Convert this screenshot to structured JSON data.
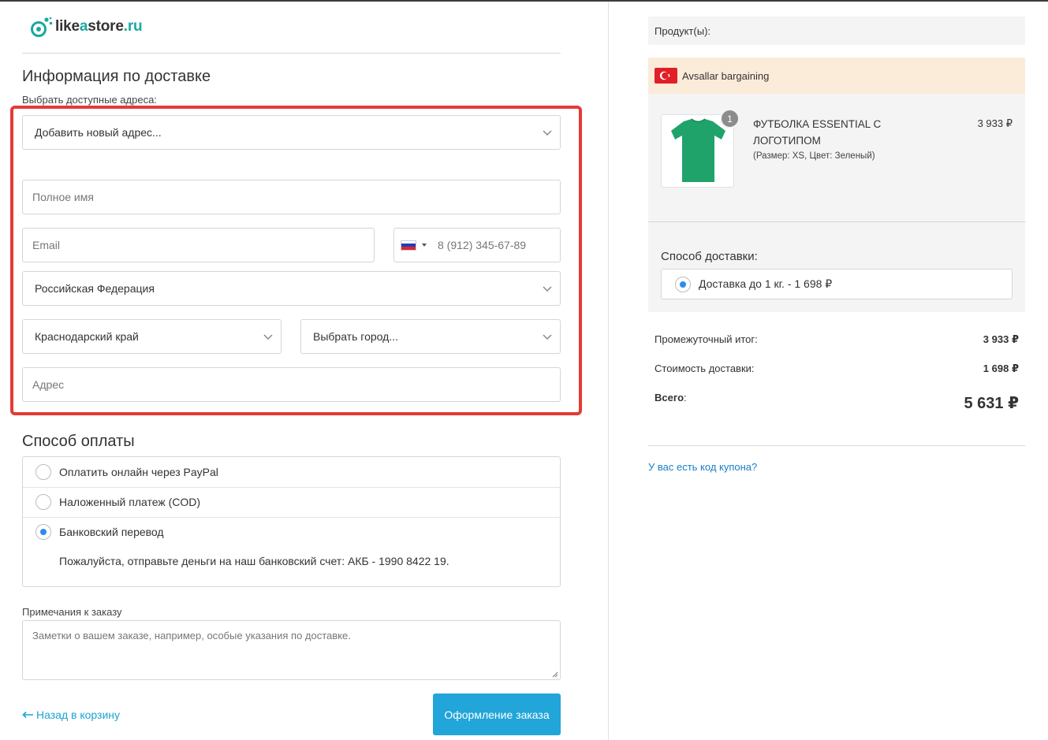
{
  "logo": {
    "part1": "like",
    "part2": "a",
    "part3": "store",
    "part4": ".ru"
  },
  "delivery": {
    "title": "Информация по доставке",
    "address_label": "Выбрать доступные адреса:",
    "address_select": "Добавить новый адрес...",
    "fullname_placeholder": "Полное имя",
    "email_placeholder": "Email",
    "phone_placeholder": "8 (912) 345-67-89",
    "country": "Российская Федерация",
    "region": "Краснодарский край",
    "city": "Выбрать город...",
    "address_placeholder": "Адрес"
  },
  "payment": {
    "title": "Способ оплаты",
    "options": [
      {
        "label": "Оплатить онлайн через PayPal",
        "selected": false
      },
      {
        "label": "Наложенный платеж (COD)",
        "selected": false
      },
      {
        "label": "Банковский перевод",
        "selected": true
      }
    ],
    "bank_note": "Пожалуйста, отправьте деньги на наш банковский счет: АКБ - 1990 8422 19."
  },
  "notes": {
    "label": "Примечания к заказу",
    "placeholder": "Заметки о вашем заказе, например, особые указания по доставке."
  },
  "footer": {
    "back_label": "Назад в корзину",
    "order_button": "Оформление заказа"
  },
  "summary": {
    "products_header": "Продукт(ы):",
    "seller": "Avsallar bargaining",
    "item": {
      "name": "ФУТБОЛКА ESSENTIAL С ЛОГОТИПОМ",
      "variant": "(Размер: XS, Цвет: Зеленый)",
      "price": "3 933 ₽",
      "qty": "1"
    },
    "shipping_title": "Способ доставки:",
    "shipping_option": "Доставка до 1 кг. - 1 698 ₽",
    "subtotal_label": "Промежуточный итог:",
    "subtotal": "3 933 ₽",
    "shipping_cost_label": "Стоимость доставки:",
    "shipping_cost": "1 698 ₽",
    "total_label": "Всего",
    "total_colon": ":",
    "total": "5 631 ₽",
    "coupon_link": "У вас есть код купона?"
  },
  "colors": {
    "accent": "#22a5d8",
    "highlight": "#e33b34",
    "seller_bg": "#fbebd9",
    "brand_teal": "#19a8a0"
  },
  "icons": [
    "logo-icon",
    "chevron-down-icon",
    "russia-flag-icon",
    "turkey-flag-icon",
    "arrow-left-icon",
    "resize-handle-icon"
  ]
}
